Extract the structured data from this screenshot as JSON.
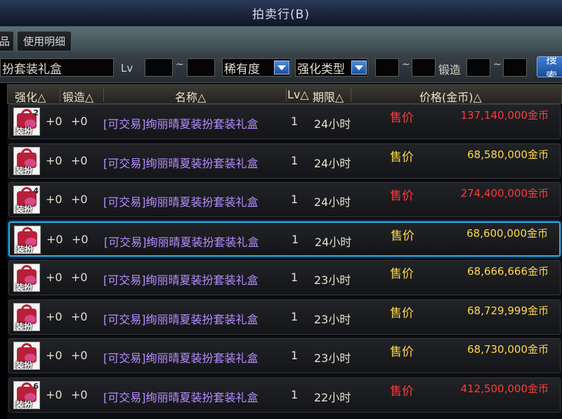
{
  "window": {
    "title": "拍卖行(B)"
  },
  "tabs": [
    {
      "label": "品"
    },
    {
      "label": "使用明细"
    }
  ],
  "filters": {
    "search_value": "扮套装礼盒",
    "lv_label": "Lv",
    "lv_min": "",
    "lv_max": "",
    "tilde": "~",
    "rarity_label": "稀有度",
    "enhance_type_label": "强化类型",
    "forge_min": "",
    "forge_max": "",
    "forge_label": "锻造",
    "search_button": "搜索"
  },
  "table": {
    "headers": {
      "enhance": "强化△",
      "forge": "锻造△",
      "name": "名称△",
      "lv": "Lv△",
      "duration": "期限△",
      "price": "价格(金币)△"
    },
    "rows": [
      {
        "qty": "2",
        "icon_label": "装扮",
        "enhance": "+0",
        "forge": "+0",
        "name": "[可交易]绚丽晴夏装扮套装礼盒",
        "lv": "1",
        "duration": "24小时",
        "price_label": "售价",
        "price": "137,140,000金币",
        "price_color": "#ff3a3a",
        "label_color": "#ff3a3a",
        "selected": false
      },
      {
        "qty": "",
        "icon_label": "装扮",
        "enhance": "+0",
        "forge": "+0",
        "name": "[可交易]绚丽晴夏装扮套装礼盒",
        "lv": "1",
        "duration": "24小时",
        "price_label": "售价",
        "price": "68,580,000金币",
        "price_color": "#ffd84a",
        "label_color": "#ffd84a",
        "selected": false
      },
      {
        "qty": "4",
        "icon_label": "装扮",
        "enhance": "+0",
        "forge": "+0",
        "name": "[可交易]绚丽晴夏装扮套装礼盒",
        "lv": "1",
        "duration": "24小时",
        "price_label": "售价",
        "price": "274,400,000金币",
        "price_color": "#ff3a3a",
        "label_color": "#ff3a3a",
        "selected": false
      },
      {
        "qty": "",
        "icon_label": "装扮",
        "enhance": "+0",
        "forge": "+0",
        "name": "[可交易]绚丽晴夏装扮套装礼盒",
        "lv": "1",
        "duration": "24小时",
        "price_label": "售价",
        "price": "68,600,000金币",
        "price_color": "#ffd84a",
        "label_color": "#ffd84a",
        "selected": true
      },
      {
        "qty": "",
        "icon_label": "装扮",
        "enhance": "+0",
        "forge": "+0",
        "name": "[可交易]绚丽晴夏装扮套装礼盒",
        "lv": "1",
        "duration": "23小时",
        "price_label": "售价",
        "price": "68,666,666金币",
        "price_color": "#ffd84a",
        "label_color": "#ffd84a",
        "selected": false
      },
      {
        "qty": "",
        "icon_label": "装扮",
        "enhance": "+0",
        "forge": "+0",
        "name": "[可交易]绚丽晴夏装扮套装礼盒",
        "lv": "1",
        "duration": "23小时",
        "price_label": "售价",
        "price": "68,729,999金币",
        "price_color": "#ffd84a",
        "label_color": "#ffd84a",
        "selected": false
      },
      {
        "qty": "",
        "icon_label": "装扮",
        "enhance": "+0",
        "forge": "+0",
        "name": "[可交易]绚丽晴夏装扮套装礼盒",
        "lv": "1",
        "duration": "23小时",
        "price_label": "售价",
        "price": "68,730,000金币",
        "price_color": "#ffd84a",
        "label_color": "#ffd84a",
        "selected": false
      },
      {
        "qty": "6",
        "icon_label": "装扮",
        "enhance": "+0",
        "forge": "+0",
        "name": "[可交易]绚丽晴夏装扮套装礼盒",
        "lv": "1",
        "duration": "22小时",
        "price_label": "售价",
        "price": "412,500,000金币",
        "price_color": "#ff3a3a",
        "label_color": "#ff3a3a",
        "selected": false
      }
    ]
  }
}
